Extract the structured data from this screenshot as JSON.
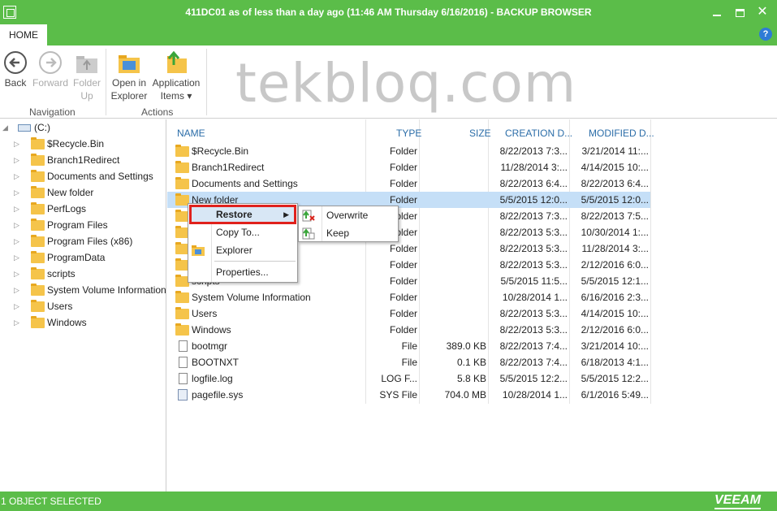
{
  "window": {
    "title": "411DC01 as of less than a day ago (11:46 AM Thursday 6/16/2016) - BACKUP BROWSER",
    "minimize_label": "",
    "help_label": "?"
  },
  "ribbon": {
    "tab_home": "HOME",
    "watermark": "tekbloq.com",
    "back_label": "Back",
    "forward_label": "Forward",
    "folder_up_label_1": "Folder",
    "folder_up_label_2": "Up",
    "open_in_explorer_1": "Open in",
    "open_in_explorer_2": "Explorer",
    "app_items_1": "Application",
    "app_items_2": "Items ▾",
    "group_navigation": "Navigation",
    "group_actions": "Actions"
  },
  "tree": {
    "root": "(C:)",
    "items": [
      "$Recycle.Bin",
      "Branch1Redirect",
      "Documents and Settings",
      "New folder",
      "PerfLogs",
      "Program Files",
      "Program Files (x86)",
      "ProgramData",
      "scripts",
      "System Volume Information",
      "Users",
      "Windows"
    ]
  },
  "list": {
    "columns": [
      "NAME",
      "TYPE",
      "SIZE",
      "CREATION D...",
      "MODIFIED D..."
    ],
    "rows": [
      {
        "name": "$Recycle.Bin",
        "type": "Folder",
        "size": "",
        "created": "8/22/2013 7:3...",
        "modified": "3/21/2014 11:...",
        "icon": "folder"
      },
      {
        "name": "Branch1Redirect",
        "type": "Folder",
        "size": "",
        "created": "11/28/2014 3:...",
        "modified": "4/14/2015 10:...",
        "icon": "folder"
      },
      {
        "name": "Documents and Settings",
        "type": "Folder",
        "size": "",
        "created": "8/22/2013 6:4...",
        "modified": "8/22/2013 6:4...",
        "icon": "folder"
      },
      {
        "name": "New folder",
        "type": "Folder",
        "size": "",
        "created": "5/5/2015 12:0...",
        "modified": "5/5/2015 12:0...",
        "icon": "folder"
      },
      {
        "name": "PerfLogs",
        "type": "Folder",
        "size": "",
        "created": "8/22/2013 7:3...",
        "modified": "8/22/2013 7:5...",
        "icon": "folder"
      },
      {
        "name": "Program Files",
        "type": "Folder",
        "size": "",
        "created": "8/22/2013 5:3...",
        "modified": "10/30/2014 1:...",
        "icon": "folder"
      },
      {
        "name": "Program Files (x86)",
        "type": "Folder",
        "size": "",
        "created": "8/22/2013 5:3...",
        "modified": "11/28/2014 3:...",
        "icon": "folder"
      },
      {
        "name": "ProgramData",
        "type": "Folder",
        "size": "",
        "created": "8/22/2013 5:3...",
        "modified": "2/12/2016 6:0...",
        "icon": "folder"
      },
      {
        "name": "scripts",
        "type": "Folder",
        "size": "",
        "created": "5/5/2015 11:5...",
        "modified": "5/5/2015 12:1...",
        "icon": "folder"
      },
      {
        "name": "System Volume Information",
        "type": "Folder",
        "size": "",
        "created": "10/28/2014 1...",
        "modified": "6/16/2016 2:3...",
        "icon": "folder"
      },
      {
        "name": "Users",
        "type": "Folder",
        "size": "",
        "created": "8/22/2013 5:3...",
        "modified": "4/14/2015 10:...",
        "icon": "folder"
      },
      {
        "name": "Windows",
        "type": "Folder",
        "size": "",
        "created": "8/22/2013 5:3...",
        "modified": "2/12/2016 6:0...",
        "icon": "folder"
      },
      {
        "name": "bootmgr",
        "type": "File",
        "size": "389.0 KB",
        "created": "8/22/2013 7:4...",
        "modified": "3/21/2014 10:...",
        "icon": "file"
      },
      {
        "name": "BOOTNXT",
        "type": "File",
        "size": "0.1 KB",
        "created": "8/22/2013 7:4...",
        "modified": "6/18/2013 4:1...",
        "icon": "file"
      },
      {
        "name": "logfile.log",
        "type": "LOG F...",
        "size": "5.8 KB",
        "created": "5/5/2015 12:2...",
        "modified": "5/5/2015 12:2...",
        "icon": "file"
      },
      {
        "name": "pagefile.sys",
        "type": "SYS File",
        "size": "704.0 MB",
        "created": "10/28/2014 1...",
        "modified": "6/1/2016 5:49...",
        "icon": "sys"
      }
    ]
  },
  "context_menu": {
    "restore": "Restore",
    "copy_to": "Copy To...",
    "explorer": "Explorer",
    "properties": "Properties..."
  },
  "submenu": {
    "overwrite": "Overwrite",
    "keep": "Keep"
  },
  "status": {
    "text": "1 OBJECT SELECTED",
    "logo": "VEEAM"
  },
  "colors": {
    "brand_green": "#5bbd49",
    "selection": "#c5dff7",
    "highlight_red": "#e0211c",
    "header_blue": "#2b6da8"
  }
}
